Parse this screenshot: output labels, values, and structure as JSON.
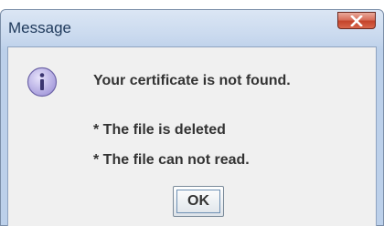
{
  "window": {
    "title": "Message",
    "close_icon": "close-icon"
  },
  "dialog": {
    "icon": "info-icon",
    "message": "Your certificate is not found.",
    "details": [
      "* The file is deleted",
      "* The file can not read."
    ],
    "ok_label": "OK"
  },
  "colors": {
    "title_text": "#1e395b",
    "close_button": "#c4442b",
    "body_background": "#f0f0f0",
    "icon_fill": "#b9b0e6"
  }
}
